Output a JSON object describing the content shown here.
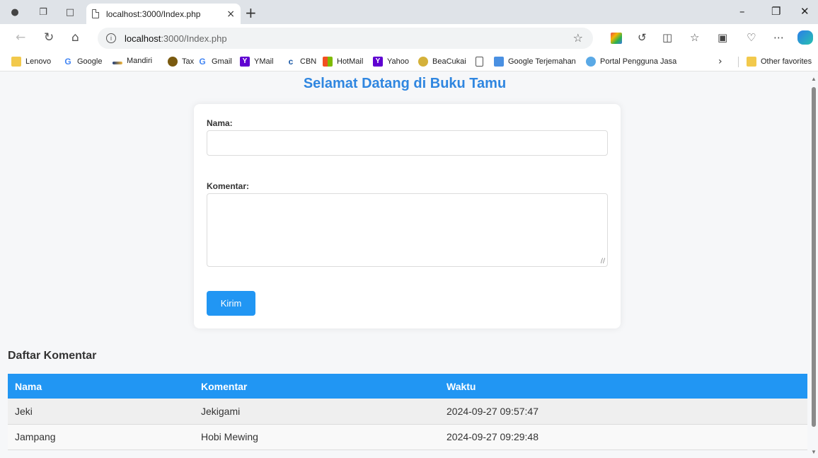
{
  "browser": {
    "tab_title": "localhost:3000/Index.php",
    "url_host": "localhost",
    "url_path": ":3000/Index.php",
    "favorites": [
      {
        "label": "Lenovo",
        "icon": "folder-icon"
      },
      {
        "label": "Google",
        "icon": "google-icon"
      },
      {
        "label": "Mandiri",
        "icon": "mandiri-icon"
      },
      {
        "label": "Tax",
        "icon": "tax-icon"
      },
      {
        "label": "Gmail",
        "icon": "google-icon"
      },
      {
        "label": "YMail",
        "icon": "yahoo-icon"
      },
      {
        "label": "CBN",
        "icon": "cbn-icon"
      },
      {
        "label": "HotMail",
        "icon": "microsoft-icon"
      },
      {
        "label": "Yahoo",
        "icon": "yahoo-icon"
      },
      {
        "label": "BeaCukai",
        "icon": "beacukai-icon"
      },
      {
        "label": "",
        "icon": "page-icon"
      },
      {
        "label": "Google Terjemahan",
        "icon": "translate-icon"
      },
      {
        "label": "Portal Pengguna Jasa",
        "icon": "portal-icon"
      }
    ],
    "other_favorites": "Other favorites"
  },
  "page": {
    "heading": "Selamat Datang di Buku Tamu",
    "form": {
      "name_label": "Nama:",
      "name_value": "",
      "comment_label": "Komentar:",
      "comment_value": "",
      "submit_label": "Kirim"
    },
    "list_title": "Daftar Komentar",
    "table": {
      "headers": [
        "Nama",
        "Komentar",
        "Waktu"
      ],
      "rows": [
        [
          "Jeki",
          "Jekigami",
          "2024-09-27 09:57:47"
        ],
        [
          "Jampang",
          "Hobi Mewing",
          "2024-09-27 09:29:48"
        ]
      ]
    }
  },
  "colors": {
    "accent": "#2196f3",
    "heading": "#2f86e0"
  }
}
